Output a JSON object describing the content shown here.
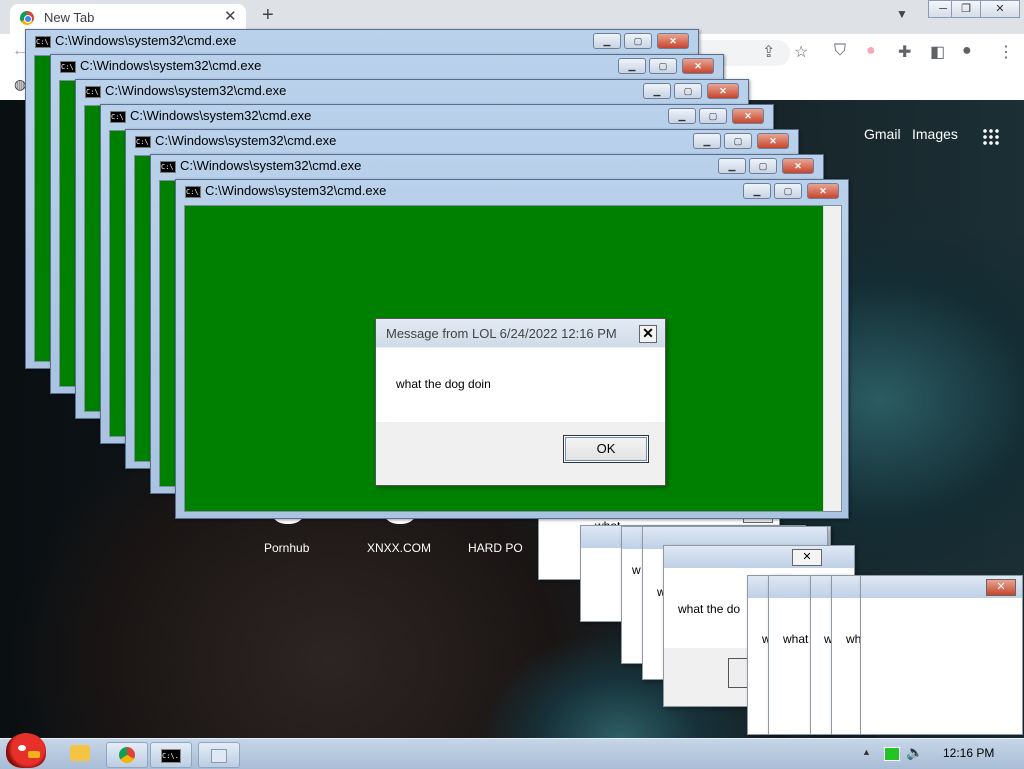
{
  "browser": {
    "tab_title": "New Tab",
    "tab_close": "✕",
    "new_tab": "+",
    "window_controls": [
      "─",
      "❐",
      "✕"
    ],
    "ntp_links": {
      "gmail": "Gmail",
      "images": "Images"
    },
    "shortcuts": [
      "Pornhub",
      "XNXX.COM",
      "HARD PO"
    ]
  },
  "cmd_windows": {
    "title": "C:\\Windows\\system32\\cmd.exe",
    "icon_text": "C:\\.",
    "buttons": {
      "minimize": "▁",
      "maximize": "▢",
      "close": "✕"
    },
    "colors": {
      "console_bg": "#008000",
      "titlebar": "#b9d1ea"
    }
  },
  "message": {
    "title": "Message from LOL 6/24/2022 12:16 PM",
    "text": "what the dog doin",
    "ok": "OK",
    "close": "✕"
  },
  "stacked_messages": {
    "text_a": "what the do",
    "text_b": "what",
    "text_c": "wh",
    "text_d": "w",
    "close": "✕"
  },
  "taskbar": {
    "time": "12:16 PM",
    "tray_expand": "▲"
  }
}
